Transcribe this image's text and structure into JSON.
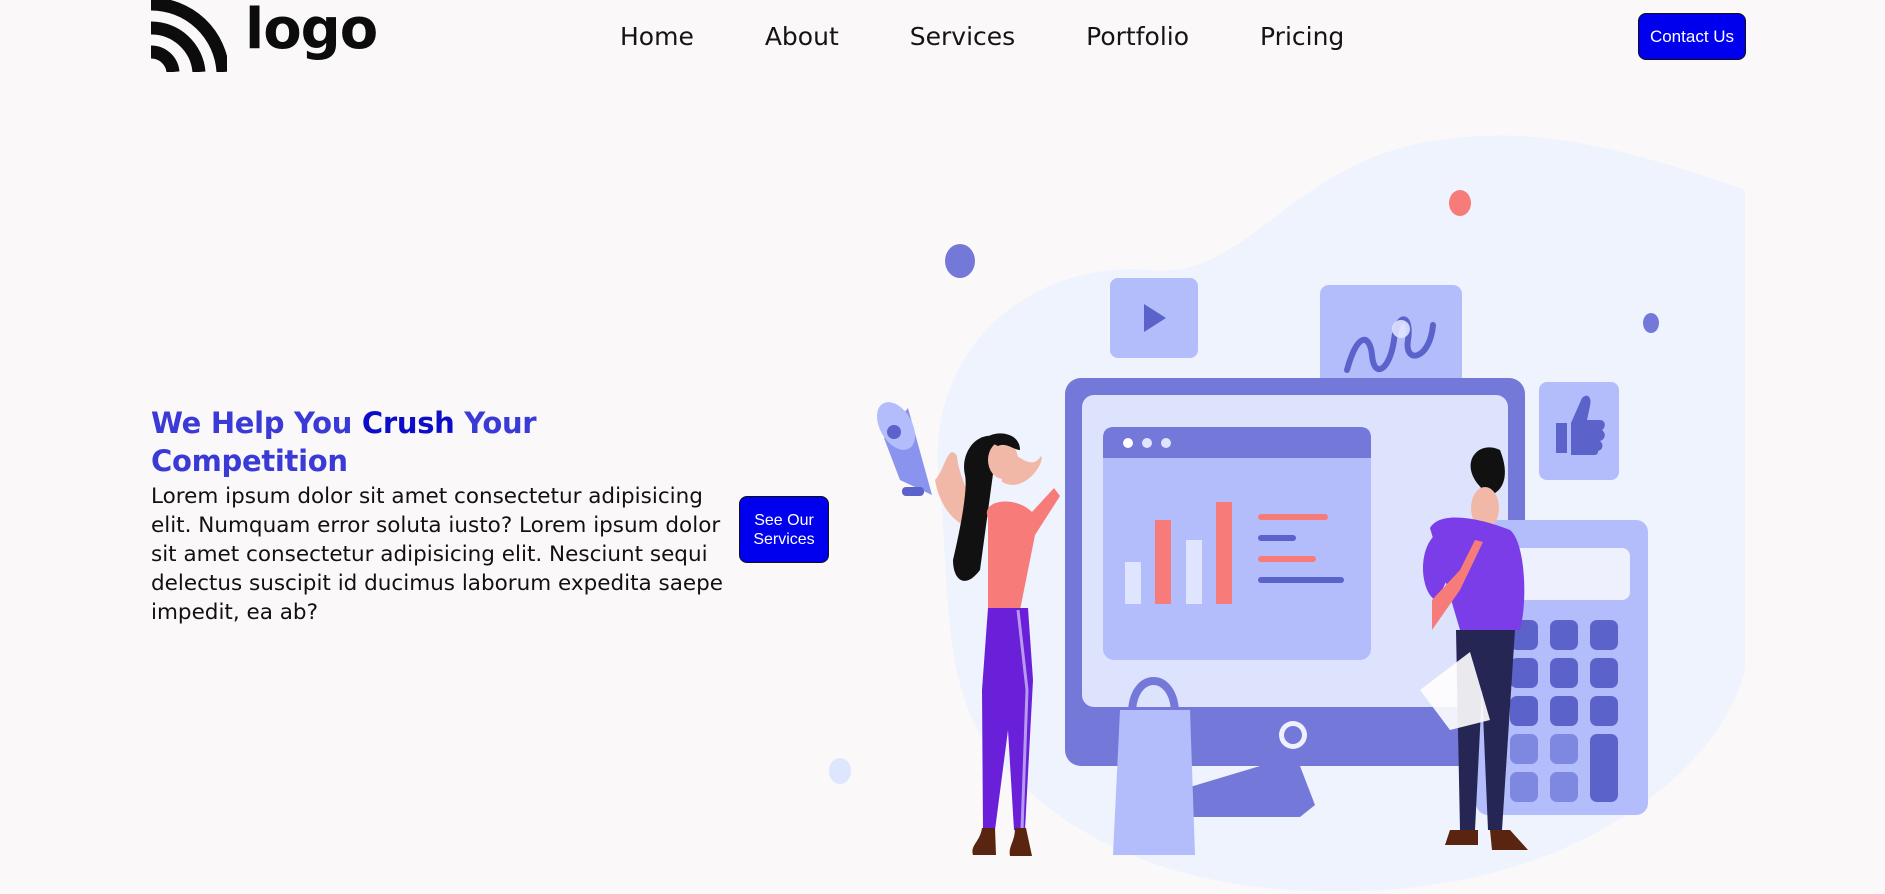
{
  "header": {
    "logo_text": "logo",
    "nav": [
      "Home",
      "About",
      "Services",
      "Portfolio",
      "Pricing"
    ],
    "contact_label": "Contact Us"
  },
  "hero": {
    "title_part1": "We Help You ",
    "title_accent": "Crush",
    "title_part2": " Your Competition",
    "body": "Lorem ipsum dolor sit amet consectetur adipisicing elit. Numquam error soluta iusto? Lorem ipsum dolor sit amet consectetur adipisicing elit. Nesciunt sequi delectus suscipit id ducimus laborum expedita saepe impedit, ea ab?",
    "cta_label": "See Our Services"
  },
  "colors": {
    "accent_button": "#0000ee",
    "title_blue": "#3a3ad6",
    "title_accent": "#0d0dc9",
    "illustration_periwinkle": "#b3bdfb",
    "illustration_indigo": "#7478d8",
    "illustration_coral": "#f77b78"
  },
  "icons": [
    "logo-mark-icon",
    "play-icon",
    "wave-chart-icon",
    "thumbs-up-icon",
    "megaphone-icon",
    "shopping-bag-icon",
    "calculator-icon"
  ]
}
